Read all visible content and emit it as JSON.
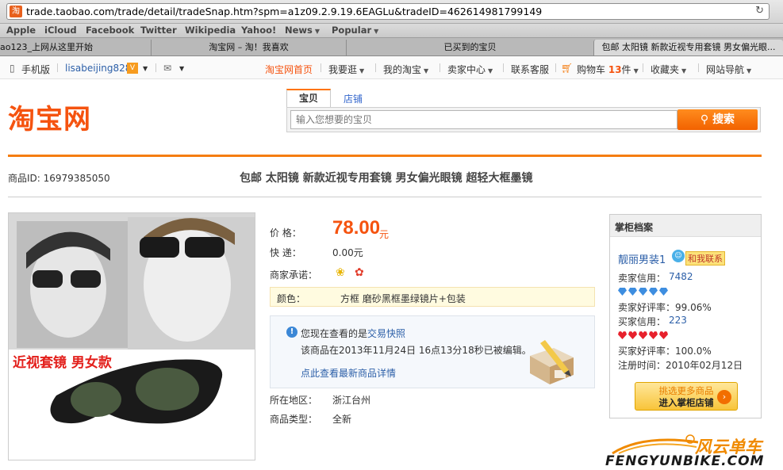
{
  "browser": {
    "url": "trade.taobao.com/trade/detail/tradeSnap.htm?spm=a1z09.2.9.19.6EAGLu&tradeID=462614981799149",
    "favicon": "淘",
    "bookmarks": [
      {
        "label": "Apple",
        "menu": false
      },
      {
        "label": "iCloud",
        "menu": false
      },
      {
        "label": "Facebook",
        "menu": false
      },
      {
        "label": "Twitter",
        "menu": false
      },
      {
        "label": "Wikipedia",
        "menu": false
      },
      {
        "label": "Yahoo!",
        "menu": false
      },
      {
        "label": "News",
        "menu": true
      },
      {
        "label": "Popular",
        "menu": true
      }
    ],
    "tabs": [
      "ao123_上网从这里开始",
      "淘宝网 – 淘！我喜欢",
      "已买到的宝贝",
      "包邮 太阳镜 新款近视专用套镜 男女偏光眼..."
    ]
  },
  "sitenav": {
    "mobile": "手机版",
    "username": "lisabeijing828",
    "home": "淘宝网首页",
    "shop": "我要逛",
    "my_taobao": "我的淘宝",
    "seller_center": "卖家中心",
    "service": "联系客服",
    "cart_label": "购物车",
    "cart_count": "13",
    "cart_unit": "件",
    "favorites": "收藏夹",
    "site_nav": "网站导航"
  },
  "header": {
    "logo": "淘宝网",
    "tab_item": "宝贝",
    "tab_shop": "店铺",
    "search_placeholder": "输入您想要的宝贝",
    "search_button": "搜索"
  },
  "item": {
    "id_label": "商品ID: 16979385050",
    "title": "包邮 太阳镜 新款近视专用套镜 男女偏光眼镜 超轻大框墨镜",
    "photo_caption": "近视套镜  男女款",
    "price_label": "价      格：",
    "price": "78.00",
    "price_unit": "元",
    "shipping_label": "快      递：",
    "shipping": "0.00元",
    "promise_label": "商家承诺：",
    "color_label": "颜色：",
    "color_value": "方框 磨砂黑框墨绿镜片+包装",
    "notice_prefix": "您现在查看的是",
    "notice_link": "交易快照",
    "notice_text": "该商品在2013年11月24日 16点13分18秒已被编辑。",
    "notice_detail_link": "点此查看最新商品详情",
    "region_label": "所在地区：",
    "region": "浙江台州",
    "type_label": "商品类型：",
    "type": "全新"
  },
  "seller": {
    "heading": "掌柜档案",
    "name": "靓丽男装1",
    "contact": "和我联系",
    "seller_credit_label": "卖家信用：",
    "seller_credit": "7482",
    "seller_rate": "卖家好评率：99.06%",
    "buyer_credit_label": "买家信用：",
    "buyer_credit": "223",
    "buyer_rate": "买家好评率：100.0%",
    "register": "注册时间：2010年02月12日",
    "enter_line1": "挑选更多商品",
    "enter_line2": "进入掌柜店铺"
  },
  "watermark": {
    "cn": "风云单车",
    "en": "FENGYUNBIKE.COM"
  },
  "colors": {
    "brand_orange": "#f5530f",
    "link_blue": "#2c5fa8"
  }
}
